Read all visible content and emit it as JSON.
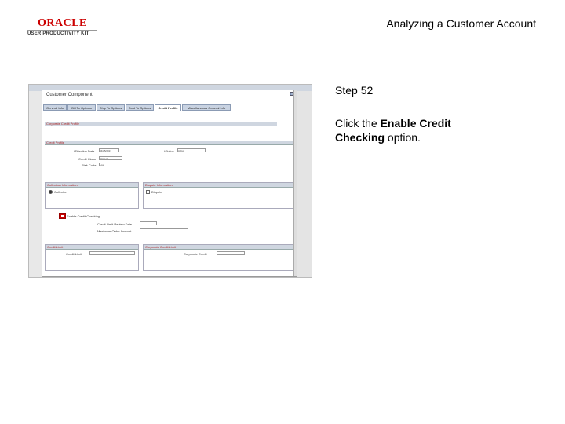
{
  "header": {
    "logo_word": "ORACLE",
    "logo_sub": "USER PRODUCTIVITY KIT",
    "doc_title": "Analyzing a Customer Account"
  },
  "step": {
    "title": "Step 52",
    "instruction_prefix": "Click the ",
    "instruction_bold": "Enable Credit Checking",
    "instruction_suffix": " option."
  },
  "screenshot": {
    "window_title": "Customer Component",
    "tabs": [
      "General Info",
      "Bill To Options",
      "Ship To Options",
      "Sold To Options",
      "Credit Profile",
      "Miscellaneous General Info"
    ],
    "active_tab": "Credit Profile",
    "sections": {
      "corporate": "Corporate Credit Profile",
      "credit_profile": "Credit Profile",
      "collection": "Collection Information",
      "dispute": "Dispute Information",
      "credit_limit": "Credit Limit",
      "corporate_limit": "Corporate Credit Limit"
    },
    "fields": {
      "effective_date_label": "*Effective Date",
      "effective_date": "04/25/2013",
      "status_label": "*Status",
      "status": "Active",
      "credit_class_label": "Credit Class",
      "credit_class": "Class A",
      "risk_code_label": "Risk Code",
      "risk_code": "Low",
      "collector_label": "Collector",
      "dispute_label": "Dispute",
      "enable_credit_checking": "Enable Credit Checking",
      "credit_limit_label": "Credit Limit Review Date",
      "max_order_label": "Maximum Order Amount",
      "credit_limit_row": "Credit Limit",
      "corporate_credit_row": "Corporate Credit"
    }
  }
}
